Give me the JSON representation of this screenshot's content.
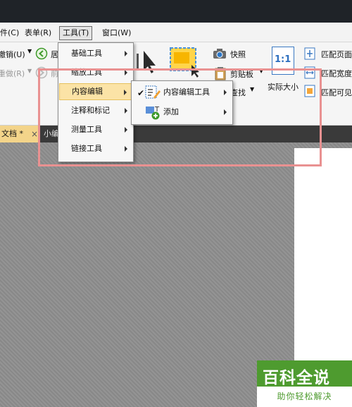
{
  "menubar": {
    "items": [
      "件(C)",
      "表单(R)",
      "工具(T)",
      "窗口(W)"
    ]
  },
  "ribbon": {
    "undo": "撤销(U)",
    "redo": "重做(R)",
    "back_partial": "居",
    "forward_partial": "前",
    "snapshot": "快照",
    "clipboard": "剪贴板",
    "find": "查找",
    "actual_size_icon": "1:1",
    "actual_size": "实际大小",
    "fit_page": "匹配页面",
    "fit_width": "匹配宽度",
    "fit_visible": "匹配可见"
  },
  "tools_menu": {
    "items": [
      "基础工具",
      "缩放工具",
      "内容编辑",
      "注释和标记",
      "测量工具",
      "链接工具"
    ]
  },
  "submenu": {
    "check": "✔",
    "items": [
      "内容编辑工具",
      "添加"
    ]
  },
  "tabs": {
    "tab1": "文档 *",
    "tab1_close": "×",
    "tab2": "小编"
  },
  "watermark": {
    "title": "百科全说",
    "subtitle": "助你轻松解决"
  },
  "colors": {
    "menu_highlight": "#fbe3a6",
    "annotation_border": "#e99191",
    "watermark_green": "#4e9b2f",
    "tab_active": "#f3d48a"
  }
}
